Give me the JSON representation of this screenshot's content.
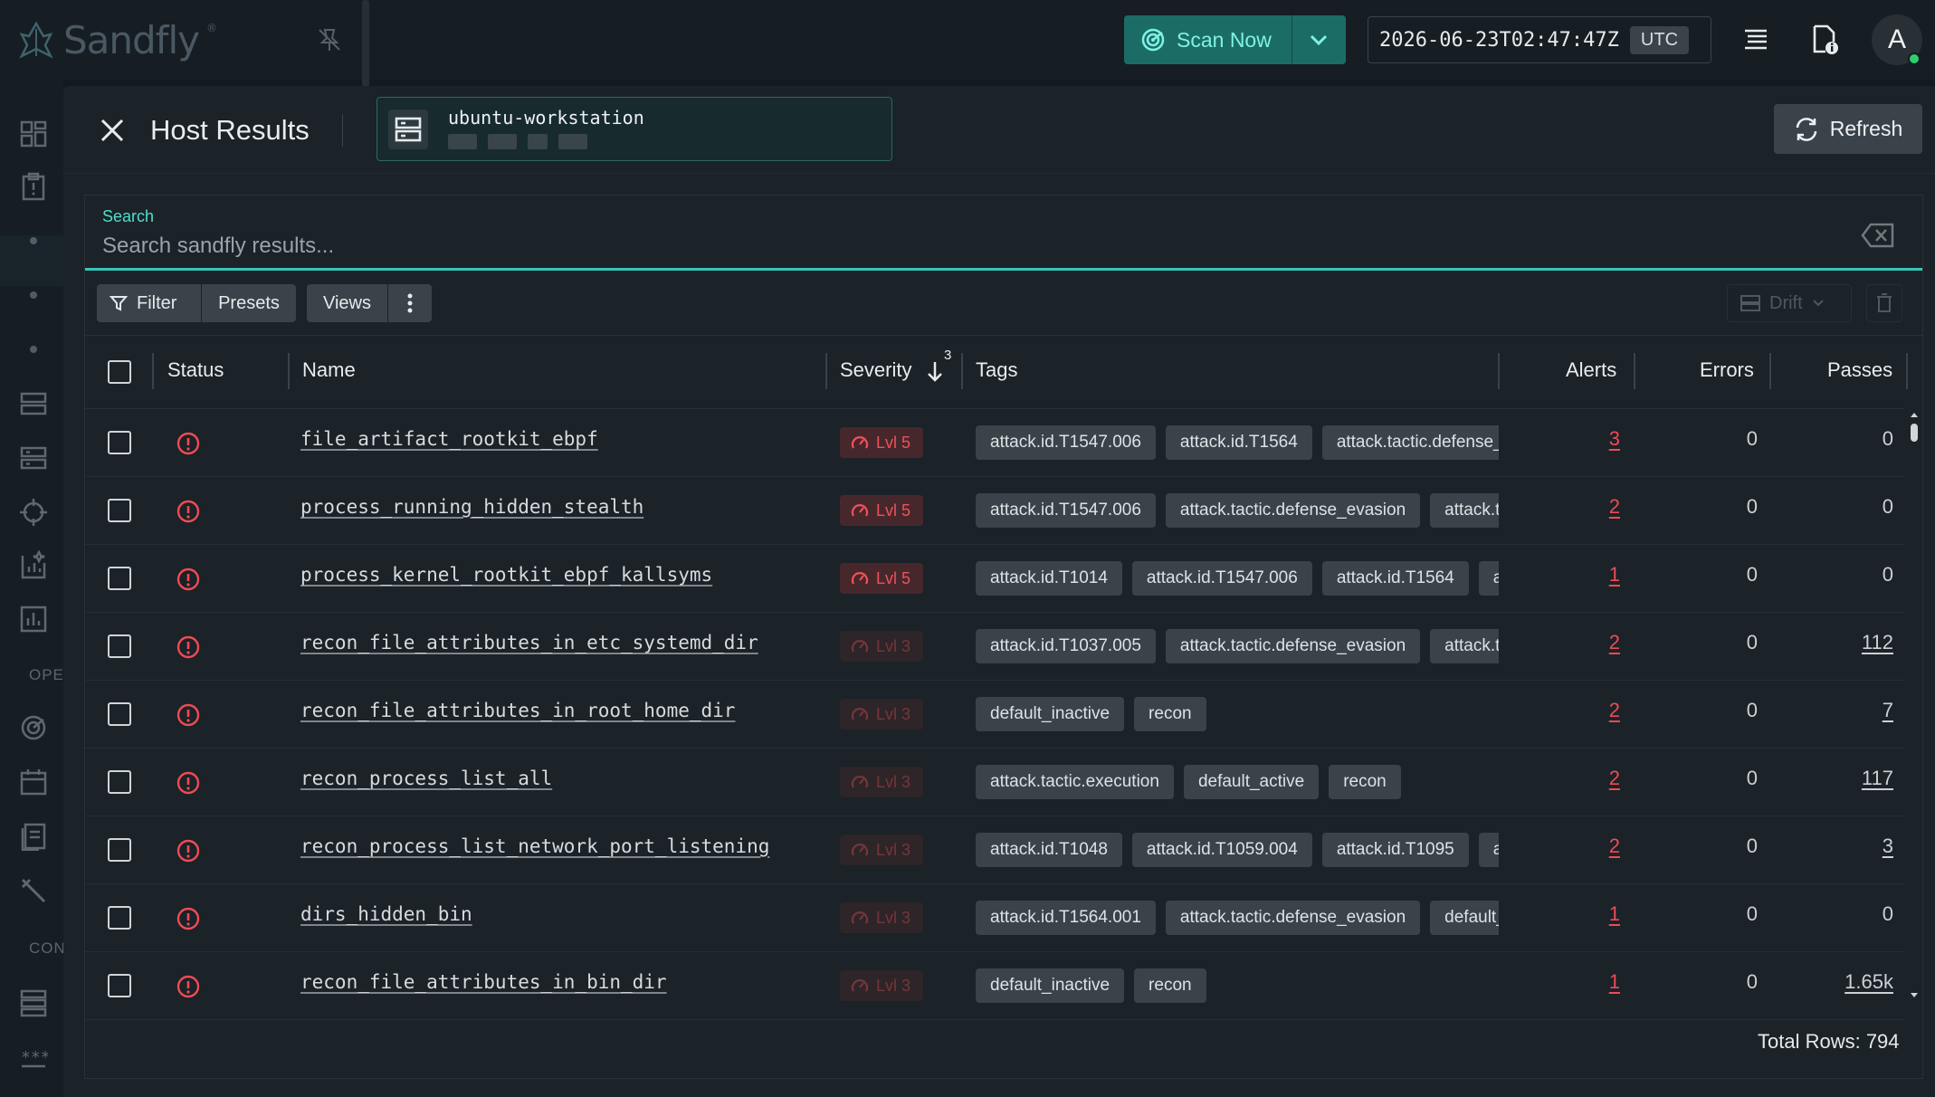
{
  "app": {
    "name": "Sandfly",
    "reg": "®"
  },
  "topbar": {
    "scan_label": "Scan Now",
    "timestamp": "2026-06-23T02:47:47Z",
    "timezone": "UTC",
    "avatar_initial": "A",
    "status_color": "#2bd16b"
  },
  "sidebar": {
    "section_ops": "OPE",
    "section_con": "CON"
  },
  "panel": {
    "title": "Host Results",
    "host_name": "ubuntu-workstation",
    "refresh_label": "Refresh"
  },
  "search": {
    "label": "Search",
    "placeholder": "Search sandfly results..."
  },
  "toolbar": {
    "filter": "Filter",
    "presets": "Presets",
    "views": "Views",
    "drift": "Drift"
  },
  "table": {
    "headers": {
      "status": "Status",
      "name": "Name",
      "severity": "Severity",
      "sort_index": "3",
      "tags": "Tags",
      "alerts": "Alerts",
      "errors": "Errors",
      "passes": "Passes"
    },
    "rows": [
      {
        "name": "file_artifact_rootkit_ebpf",
        "severity": "Lvl 5",
        "level": 5,
        "tags": [
          "attack.id.T1547.006",
          "attack.id.T1564",
          "attack.tactic.defense_evasion"
        ],
        "alerts": "3",
        "errors": "0",
        "passes": "0"
      },
      {
        "name": "process_running_hidden_stealth",
        "severity": "Lvl 5",
        "level": 5,
        "tags": [
          "attack.id.T1547.006",
          "attack.tactic.defense_evasion",
          "attack.tactic.persistence"
        ],
        "alerts": "2",
        "errors": "0",
        "passes": "0"
      },
      {
        "name": "process_kernel_rootkit_ebpf_kallsyms",
        "severity": "Lvl 5",
        "level": 5,
        "tags": [
          "attack.id.T1014",
          "attack.id.T1547.006",
          "attack.id.T1564",
          "attack.tactic.defense_evasion"
        ],
        "alerts": "1",
        "errors": "0",
        "passes": "0"
      },
      {
        "name": "recon_file_attributes_in_etc_systemd_dir",
        "severity": "Lvl 3",
        "level": 3,
        "tags": [
          "attack.id.T1037.005",
          "attack.tactic.defense_evasion",
          "attack.tactic.persistence"
        ],
        "alerts": "2",
        "errors": "0",
        "passes": "112"
      },
      {
        "name": "recon_file_attributes_in_root_home_dir",
        "severity": "Lvl 3",
        "level": 3,
        "tags": [
          "default_inactive",
          "recon"
        ],
        "alerts": "2",
        "errors": "0",
        "passes": "7"
      },
      {
        "name": "recon_process_list_all",
        "severity": "Lvl 3",
        "level": 3,
        "tags": [
          "attack.tactic.execution",
          "default_active",
          "recon"
        ],
        "alerts": "2",
        "errors": "0",
        "passes": "117"
      },
      {
        "name": "recon_process_list_network_port_listening",
        "severity": "Lvl 3",
        "level": 3,
        "tags": [
          "attack.id.T1048",
          "attack.id.T1059.004",
          "attack.id.T1095",
          "attack.tactic.exfiltration"
        ],
        "alerts": "2",
        "errors": "0",
        "passes": "3"
      },
      {
        "name": "dirs_hidden_bin",
        "severity": "Lvl 3",
        "level": 3,
        "tags": [
          "attack.id.T1564.001",
          "attack.tactic.defense_evasion",
          "default_active"
        ],
        "alerts": "1",
        "errors": "0",
        "passes": "0"
      },
      {
        "name": "recon_file_attributes_in_bin_dir",
        "severity": "Lvl 3",
        "level": 3,
        "tags": [
          "default_inactive",
          "recon"
        ],
        "alerts": "1",
        "errors": "0",
        "passes": "1.65k"
      }
    ],
    "total_rows": "Total Rows: 794"
  },
  "colors": {
    "accent": "#33c7b7",
    "alert": "#ee4b55",
    "scan_bg": "#1c6c66"
  }
}
